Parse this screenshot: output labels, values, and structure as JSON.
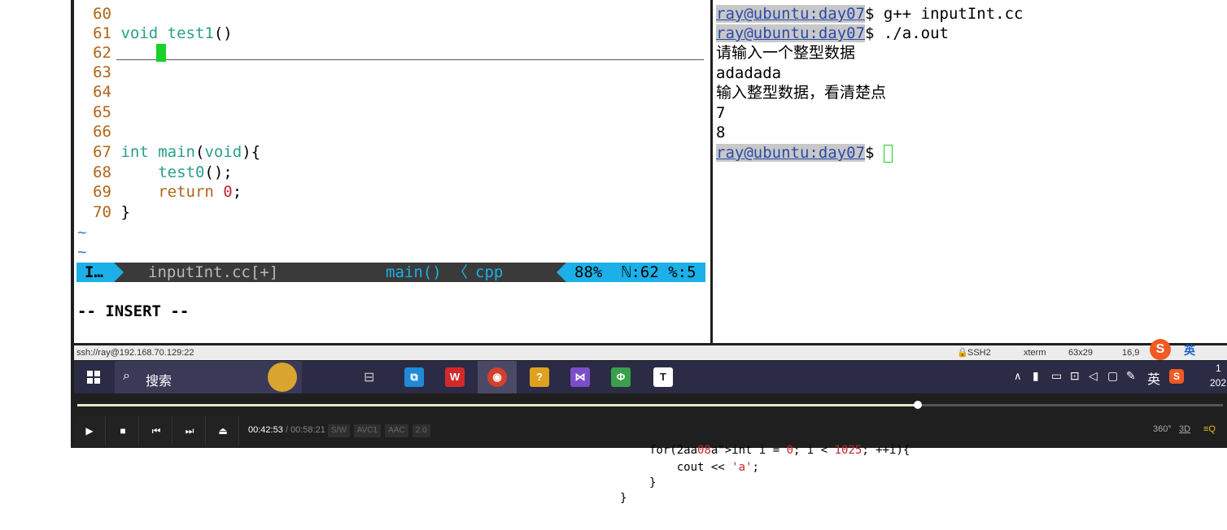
{
  "vim": {
    "lines": [
      {
        "n": "60",
        "code": []
      },
      {
        "n": "61",
        "code": [
          {
            "t": "void ",
            "c": "kw"
          },
          {
            "t": "test1",
            "c": "fn"
          },
          {
            "t": "()",
            "c": ""
          }
        ]
      },
      {
        "n": "62",
        "code": []
      },
      {
        "n": "63",
        "code": []
      },
      {
        "n": "64",
        "code": []
      },
      {
        "n": "65",
        "code": []
      },
      {
        "n": "66",
        "code": []
      },
      {
        "n": "67",
        "code": [
          {
            "t": "int ",
            "c": "kw"
          },
          {
            "t": "main",
            "c": "fn"
          },
          {
            "t": "(",
            "c": ""
          },
          {
            "t": "void",
            "c": "kw"
          },
          {
            "t": "){",
            "c": ""
          }
        ]
      },
      {
        "n": "68",
        "code": [
          {
            "t": "    test0",
            "c": "fn"
          },
          {
            "t": "();",
            "c": ""
          }
        ]
      },
      {
        "n": "69",
        "code": [
          {
            "t": "    return ",
            "c": "ret"
          },
          {
            "t": "0",
            "c": "num"
          },
          {
            "t": ";",
            "c": ""
          }
        ]
      },
      {
        "n": "70",
        "code": [
          {
            "t": "}",
            "c": ""
          }
        ]
      }
    ],
    "tildes": [
      "~",
      "~"
    ],
    "status": {
      "mode": "I…",
      "filename": "inputInt.cc[+]",
      "function": "main()",
      "separator": "〈",
      "filetype": "cpp",
      "percent": "88%",
      "position": "ℕ:62 %:5"
    },
    "insert_label": "-- INSERT --"
  },
  "terminal": {
    "lines": [
      {
        "prompt": "ray@ubuntu:day07",
        "rest": "$ g++ inputInt.cc"
      },
      {
        "prompt": "ray@ubuntu:day07",
        "rest": "$ ./a.out"
      },
      {
        "text": "请输入一个整型数据"
      },
      {
        "text": "adadada"
      },
      {
        "text": "输入整型数据，看清楚点"
      },
      {
        "text": "7"
      },
      {
        "text": "8"
      },
      {
        "prompt": "ray@ubuntu:day07",
        "rest": "$ "
      }
    ]
  },
  "xshell_bar": {
    "session": "ssh://ray@192.168.70.129:22",
    "protocol": "SSH2",
    "term": "xterm",
    "size": "63x29",
    "cursor": "16,9",
    "ime": "英"
  },
  "taskbar": {
    "search_label": "搜索",
    "tray_lang": "英",
    "clock_partial": "1",
    "year_partial": "202"
  },
  "player": {
    "time_current": "00:42:53",
    "time_total": "/ 00:58:21",
    "tags": [
      "S/W",
      "AVC1",
      "AAC",
      "2.0"
    ],
    "right": [
      "360°",
      "3D",
      "≡Q"
    ],
    "progress": 0.733
  },
  "bottom_code": {
    "line1": "for(int i = 0; i < 1025; ++i){",
    "line2": "    cout << 'a';",
    "line3": "}",
    "line4": "}"
  },
  "colors": {
    "accent": "#1bb1e8",
    "cursor": "#17d22a",
    "prompt": "#2b4aa8"
  }
}
